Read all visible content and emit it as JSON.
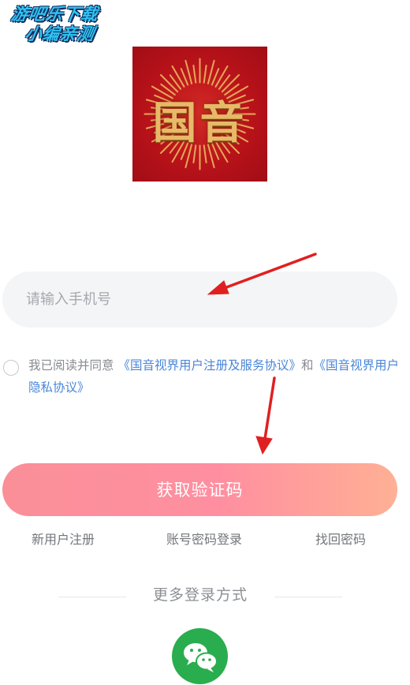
{
  "watermark": {
    "line1": "游吧乐下载",
    "line2": "小编亲测"
  },
  "logo": {
    "text": "国音"
  },
  "phone": {
    "placeholder": "请输入手机号"
  },
  "agreement": {
    "prefix": "我已阅读并同意 ",
    "link1": "《国音视界用户注册及服务协议》",
    "conjunction": "和",
    "link2": "《国音视界用户隐私协议》"
  },
  "actions": {
    "get_code": "获取验证码",
    "register": "新用户注册",
    "password_login": "账号密码登录",
    "recover_password": "找回密码"
  },
  "more_login": {
    "title": "更多登录方式",
    "wechat_icon": "wechat-icon"
  },
  "colors": {
    "button_gradient_start": "#fa8f98",
    "button_gradient_end": "#ffb095",
    "link": "#4a86d8",
    "wechat": "#2aad4e",
    "logo_red": "#b8121a",
    "logo_gold": "#e7b968",
    "annotation_arrow": "#e02020"
  }
}
